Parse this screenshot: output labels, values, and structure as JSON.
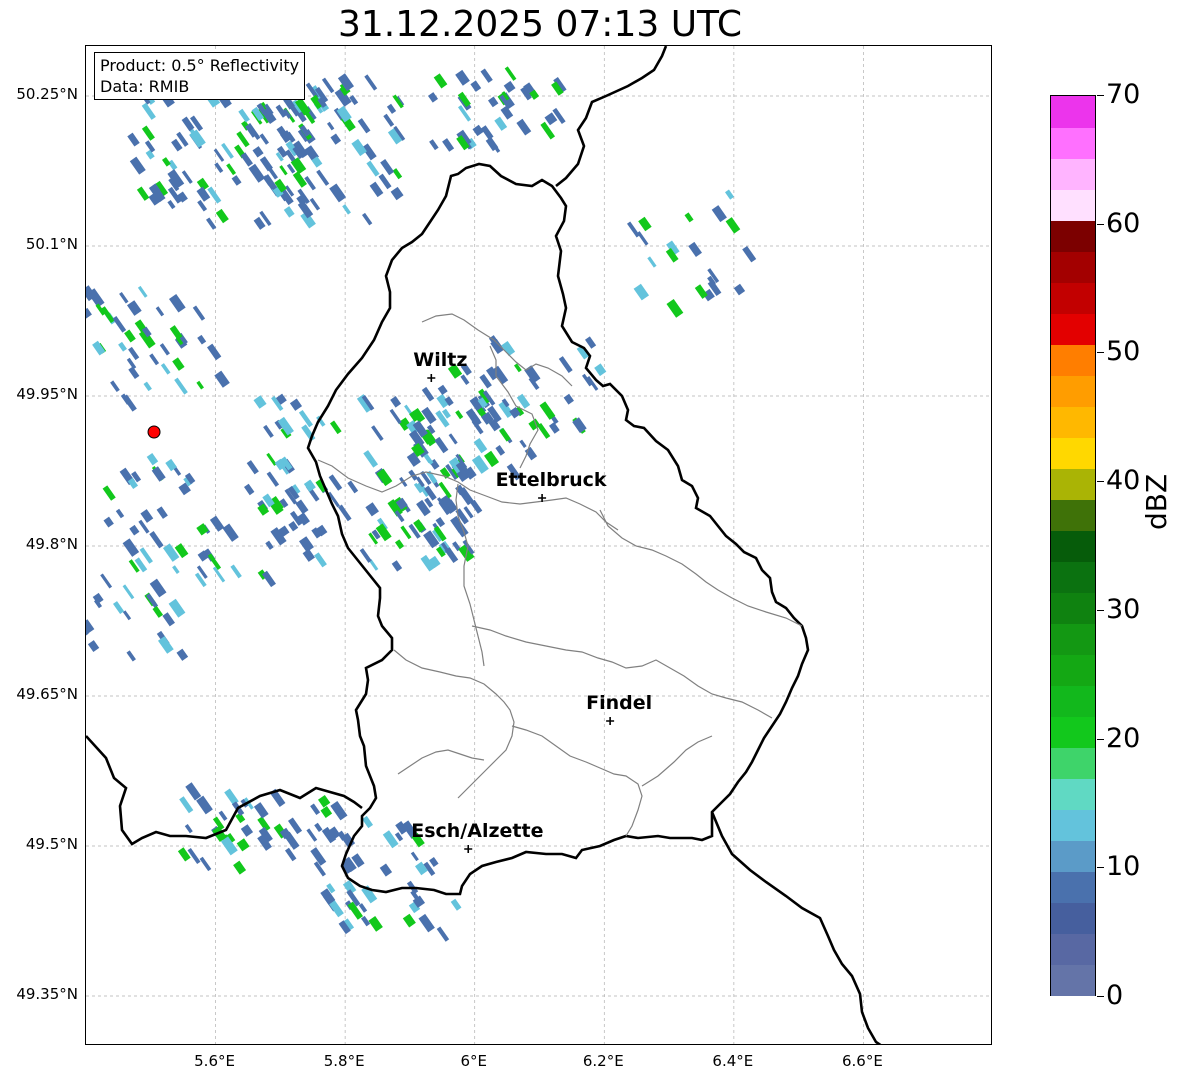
{
  "title": "31.12.2025 07:13 UTC",
  "info_box": {
    "product": "Product: 0.5° Reflectivity",
    "source": "Data: RMIB"
  },
  "map": {
    "lon_range": [
      5.4,
      6.8
    ],
    "lat_range": [
      49.3,
      50.3
    ],
    "lat_ticks": [
      {
        "value": 50.25,
        "label": "50.25°N"
      },
      {
        "value": 50.1,
        "label": "50.1°N"
      },
      {
        "value": 49.95,
        "label": "49.95°N"
      },
      {
        "value": 49.8,
        "label": "49.8°N"
      },
      {
        "value": 49.65,
        "label": "49.65°N"
      },
      {
        "value": 49.5,
        "label": "49.5°N"
      },
      {
        "value": 49.35,
        "label": "49.35°N"
      }
    ],
    "lon_ticks": [
      {
        "value": 5.6,
        "label": "5.6°E"
      },
      {
        "value": 5.8,
        "label": "5.8°E"
      },
      {
        "value": 6.0,
        "label": "6°E"
      },
      {
        "value": 6.2,
        "label": "6.2°E"
      },
      {
        "value": 6.4,
        "label": "6.4°E"
      },
      {
        "value": 6.6,
        "label": "6.6°E"
      }
    ],
    "grid": true,
    "cities": [
      {
        "name": "Wiltz",
        "lon": 5.933,
        "lat": 49.968
      },
      {
        "name": "Ettelbruck",
        "lon": 6.104,
        "lat": 49.848
      },
      {
        "name": "Findel",
        "lon": 6.209,
        "lat": 49.625
      },
      {
        "name": "Esch/Alzette",
        "lon": 5.99,
        "lat": 49.497
      }
    ],
    "radar_site": {
      "lon": 5.505,
      "lat": 49.914,
      "color": "#ff0000"
    }
  },
  "colorbar": {
    "label": "dBZ",
    "min": 0,
    "max": 70,
    "tick_labels": [
      "0",
      "10",
      "20",
      "30",
      "40",
      "50",
      "60",
      "70"
    ],
    "colors": [
      "#6474a8",
      "#5868a3",
      "#465f9e",
      "#4a71ad",
      "#5b9bc8",
      "#63c3dc",
      "#60d9c3",
      "#3ed46a",
      "#12c81c",
      "#12b81c",
      "#14a814",
      "#139813",
      "#0f8210",
      "#0b7210",
      "#065c0a",
      "#3f7208",
      "#aab405",
      "#ffd800",
      "#ffb800",
      "#ff9d00",
      "#ff7e00",
      "#e30000",
      "#c20000",
      "#a30000",
      "#7c0000",
      "#ffe0ff",
      "#ffb4ff",
      "#ff70ff",
      "#ec34ec"
    ]
  },
  "colors": {
    "border": "#000000",
    "canton_lines": "#808080",
    "gridline": "#b0b0b0",
    "echo_light": "#4a71ad",
    "echo_medium": "#63c3dc",
    "echo_strong": "#12c81c"
  }
}
